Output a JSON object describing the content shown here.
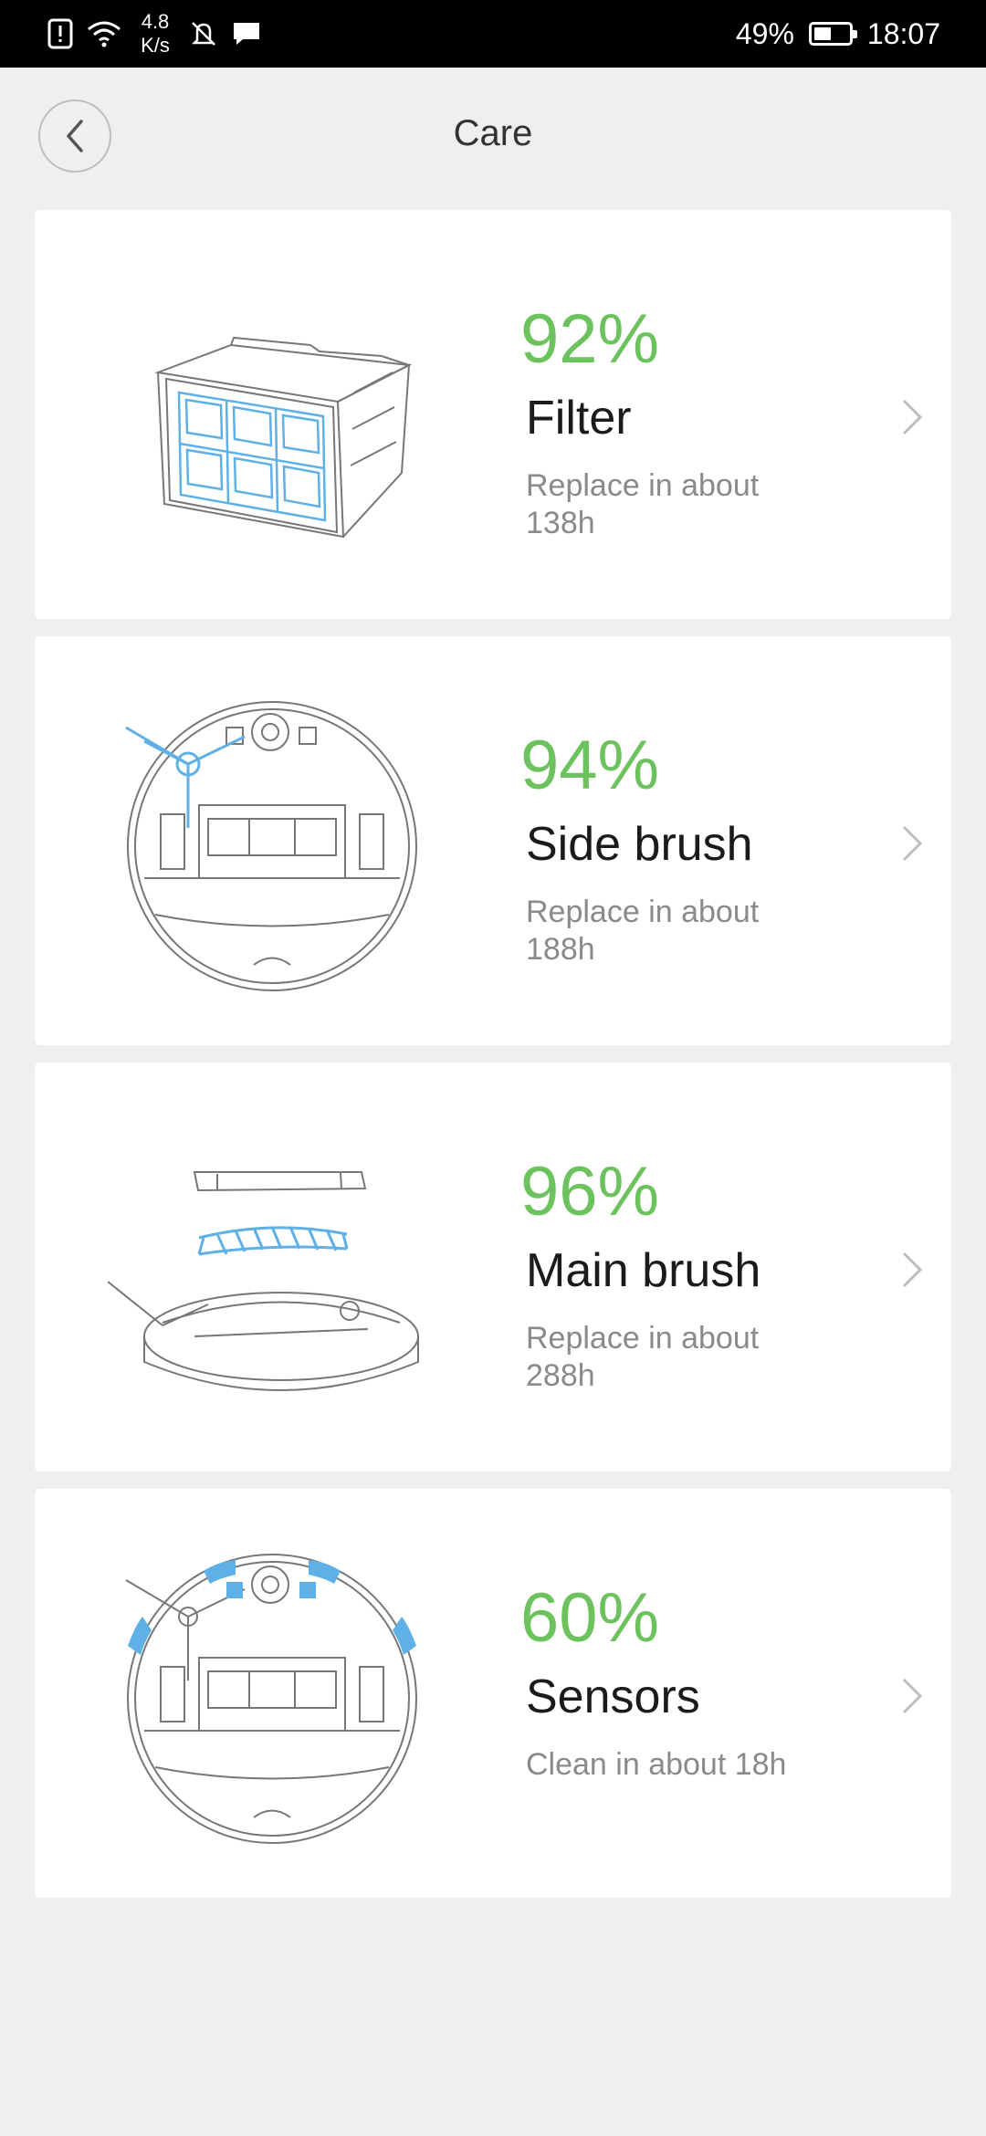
{
  "status_bar": {
    "net_speed_value": "4.8",
    "net_speed_unit": "K/s",
    "battery_percent": "49%",
    "battery_level": 0.49,
    "time": "18:07"
  },
  "header": {
    "title": "Care"
  },
  "colors": {
    "accent_green": "#6cc25d",
    "illustration_blue": "#5fb0e6"
  },
  "items": [
    {
      "percent": "92%",
      "name": "Filter",
      "desc": "Replace in about 138h",
      "image": "filter-illustration"
    },
    {
      "percent": "94%",
      "name": "Side brush",
      "desc": "Replace in about 188h",
      "image": "side-brush-illustration"
    },
    {
      "percent": "96%",
      "name": "Main brush",
      "desc": "Replace in about 288h",
      "image": "main-brush-illustration"
    },
    {
      "percent": "60%",
      "name": "Sensors",
      "desc": "Clean in about 18h",
      "image": "sensors-illustration"
    }
  ]
}
